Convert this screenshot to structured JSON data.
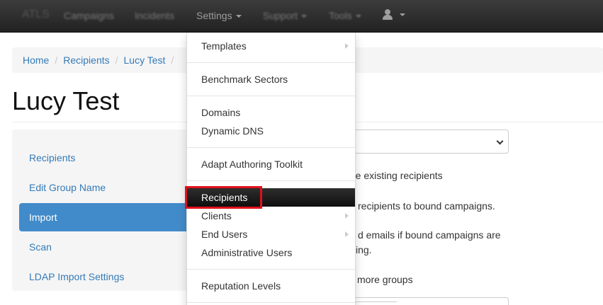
{
  "navbar": {
    "brand": "ATLS",
    "items": [
      {
        "label": "Campaigns"
      },
      {
        "label": "Incidents"
      },
      {
        "label": "Settings"
      },
      {
        "label": "Support"
      },
      {
        "label": "Tools"
      }
    ]
  },
  "breadcrumb": [
    "Home",
    "Recipients",
    "Lucy Test"
  ],
  "page_title": "Lucy Test",
  "sidenav": {
    "items": [
      {
        "label": "Recipients",
        "active": false
      },
      {
        "label": "Edit Group Name",
        "active": false
      },
      {
        "label": "Import",
        "active": true
      },
      {
        "label": "Scan",
        "active": false
      },
      {
        "label": "LDAP Import Settings",
        "active": false
      }
    ]
  },
  "right_panel": {
    "lines": [
      "ate existing recipients",
      "recipients to bound campaigns.",
      "d emails if bound campaigns are",
      "ing.",
      "more groups"
    ]
  },
  "settings_menu": {
    "items": [
      {
        "label": "Templates",
        "has_submenu": true
      },
      {
        "label": "Benchmark Sectors",
        "has_submenu": false
      },
      {
        "label": "Domains",
        "has_submenu": false
      },
      {
        "label": "Dynamic DNS",
        "has_submenu": false
      },
      {
        "label": "Adapt Authoring Toolkit",
        "has_submenu": false
      },
      {
        "label": "Recipients",
        "has_submenu": false,
        "active": true
      },
      {
        "label": "Clients",
        "has_submenu": true
      },
      {
        "label": "End Users",
        "has_submenu": true
      },
      {
        "label": "Administrative Users",
        "has_submenu": false
      },
      {
        "label": "Reputation Levels",
        "has_submenu": false
      }
    ]
  },
  "colors": {
    "link": "#337ab7",
    "active_nav": "#428bca",
    "highlight": "#e0101a"
  }
}
